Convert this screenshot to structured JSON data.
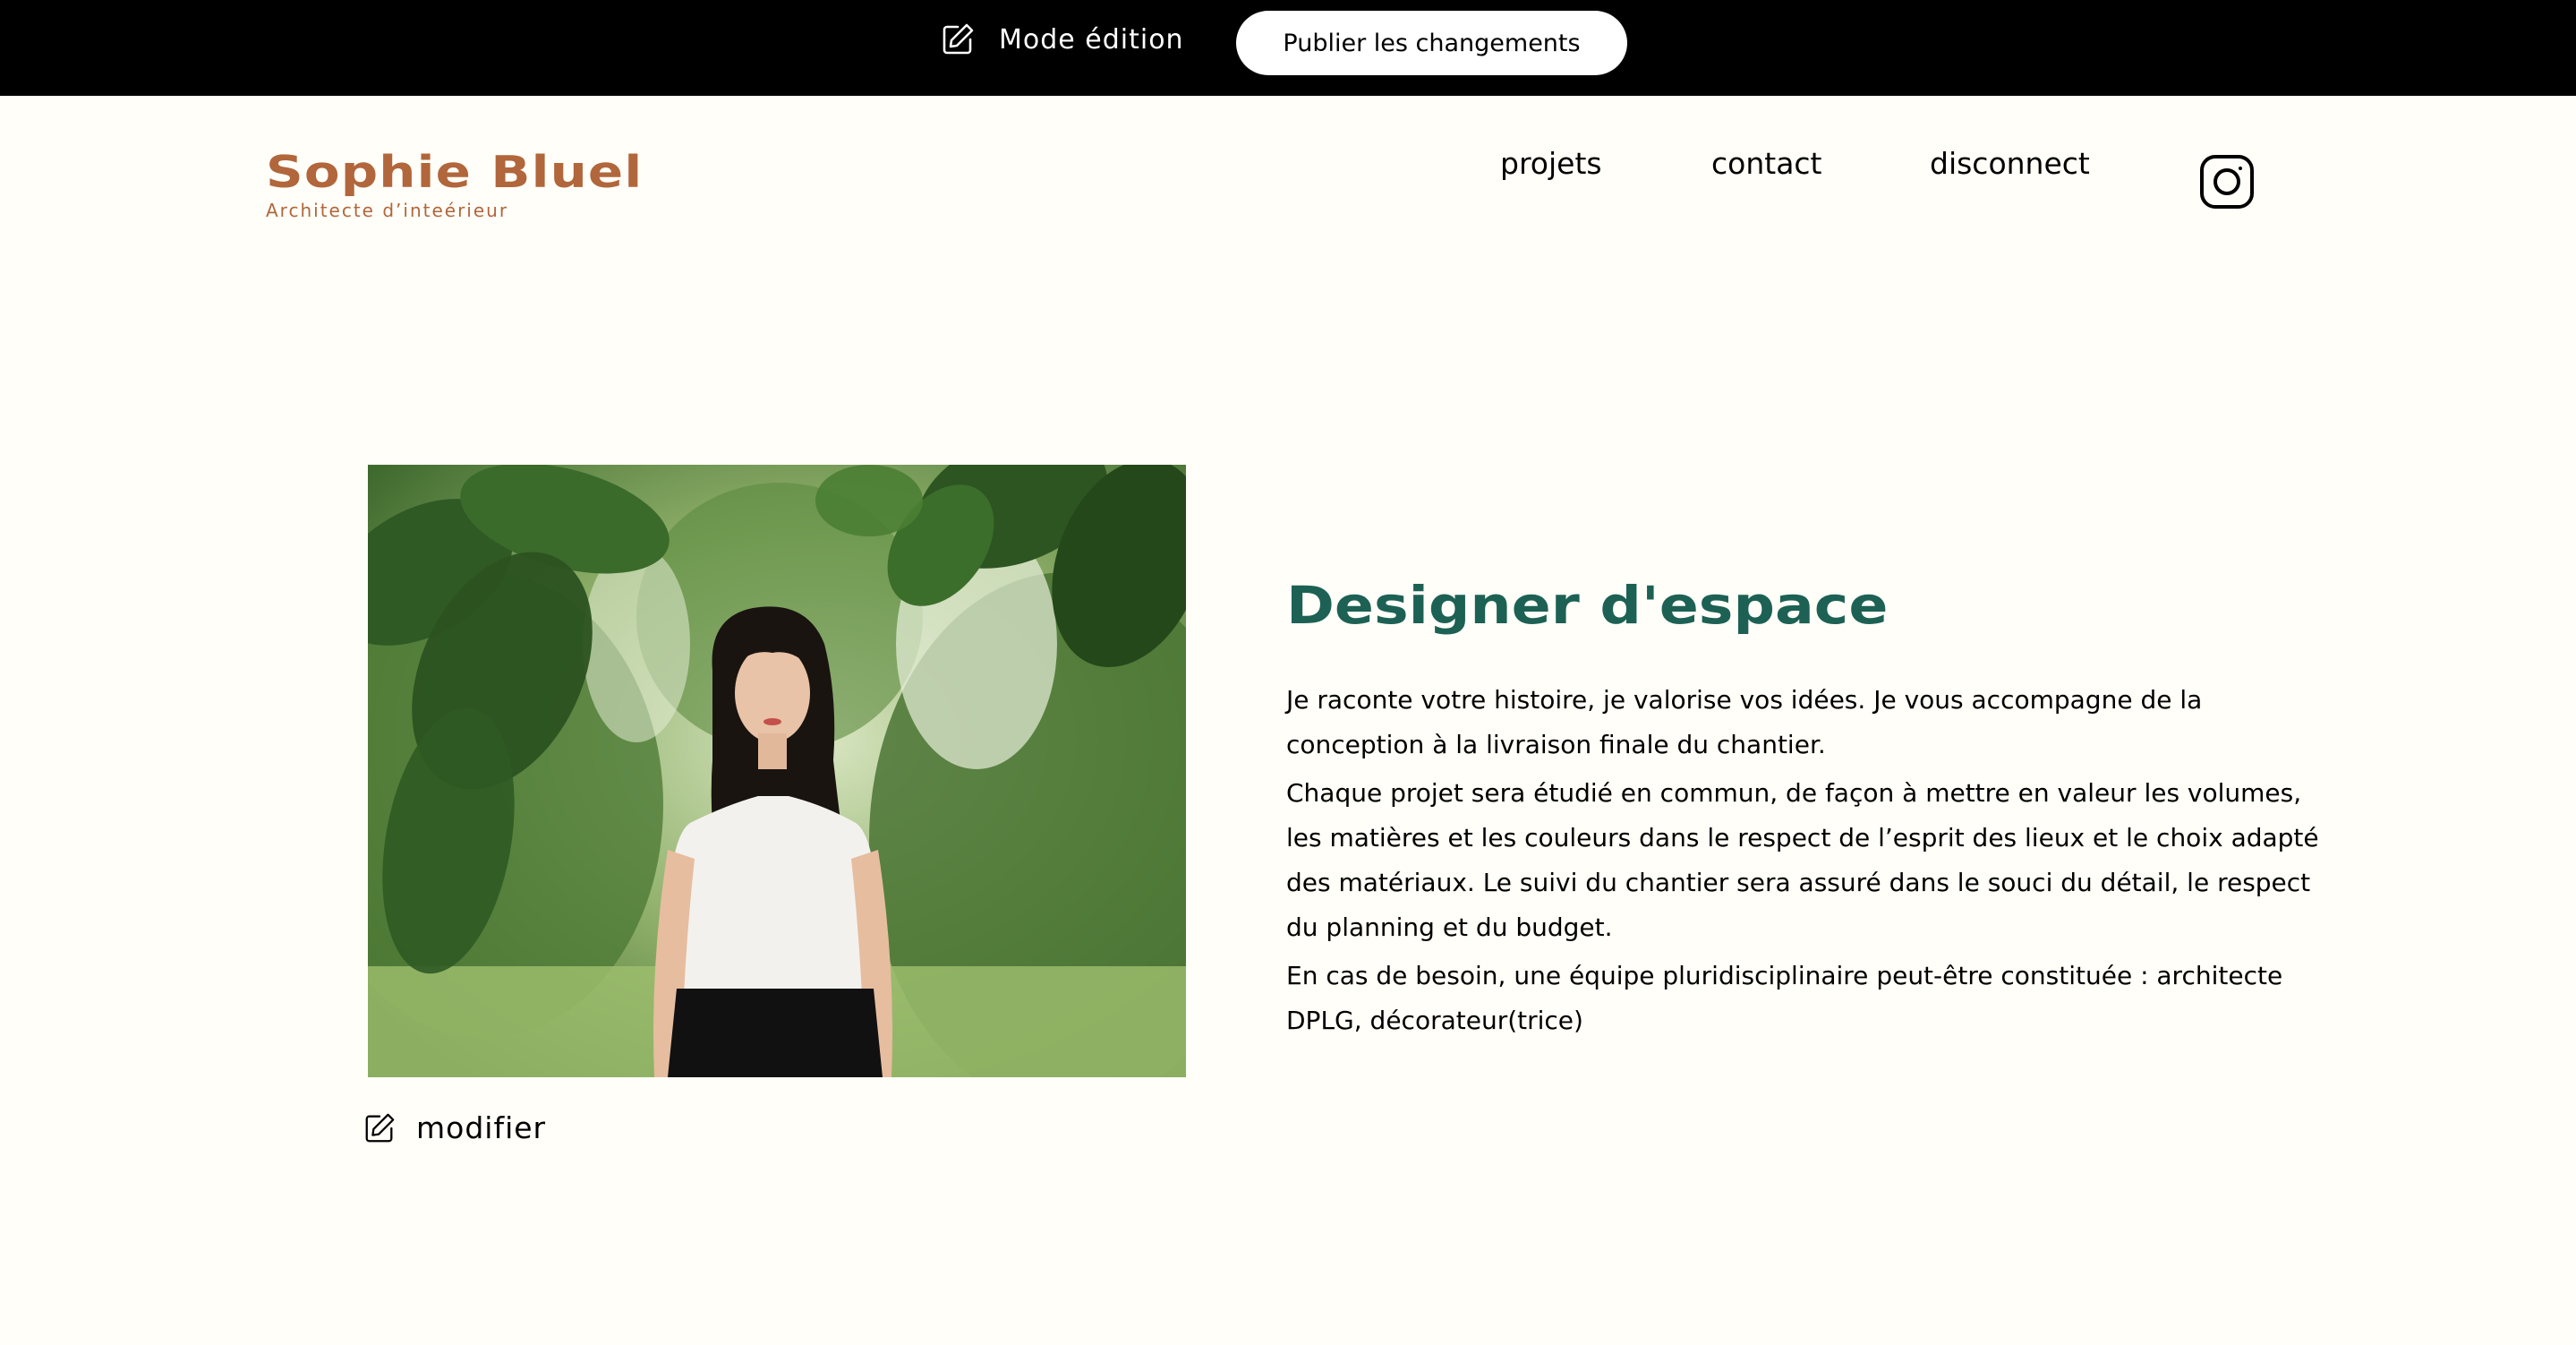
{
  "edit_bar": {
    "mode_label": "Mode édition",
    "publish_label": "Publier les changements",
    "icon": "edit-icon"
  },
  "header": {
    "logo_name": "Sophie Bluel",
    "logo_subtitle": "Architecte d’inteérieur",
    "nav": {
      "projets": "projets",
      "contact": "contact",
      "disconnect": "disconnect"
    },
    "social_icon": "instagram-icon"
  },
  "intro": {
    "modify_label": "modifier",
    "modify_icon": "edit-icon",
    "title": "Designer d'espace",
    "paragraphs": [
      "Je raconte votre histoire, je valorise vos idées. Je vous accompagne de la conception à la livraison finale du chantier.",
      "Chaque projet sera étudié en commun, de façon à mettre en valeur les volumes, les matières et les couleurs dans le respect de l’esprit des lieux et le choix adapté des matériaux. Le suivi du chantier sera assuré dans le souci du détail, le respect du planning et du budget.",
      "En cas de besoin, une équipe pluridisciplinaire peut-être constituée : architecte DPLG, décorateur(trice)"
    ]
  },
  "colors": {
    "background": "#FFFEF8",
    "edit_bar": "#000000",
    "brand": "#B1663C",
    "title": "#1D6154"
  }
}
